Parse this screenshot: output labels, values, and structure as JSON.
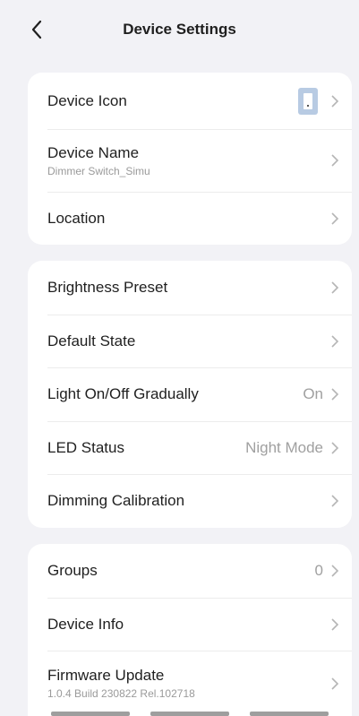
{
  "header": {
    "title": "Device Settings"
  },
  "groups": [
    {
      "rows": [
        {
          "label": "Device Icon",
          "icon": "switch-device-icon"
        },
        {
          "label": "Device Name",
          "sub": "Dimmer Switch_Simu"
        },
        {
          "label": "Location"
        }
      ]
    },
    {
      "rows": [
        {
          "label": "Brightness Preset"
        },
        {
          "label": "Default State"
        },
        {
          "label": "Light On/Off Gradually",
          "value": "On"
        },
        {
          "label": "LED Status",
          "value": "Night Mode"
        },
        {
          "label": "Dimming Calibration"
        }
      ]
    },
    {
      "rows": [
        {
          "label": "Groups",
          "value": "0"
        },
        {
          "label": "Device Info"
        },
        {
          "label": "Firmware Update",
          "sub": "1.0.4 Build 230822 Rel.102718"
        }
      ]
    }
  ],
  "colors": {
    "background": "#f2f2f6",
    "card": "#ffffff",
    "device_icon": "#b8cbe3"
  }
}
